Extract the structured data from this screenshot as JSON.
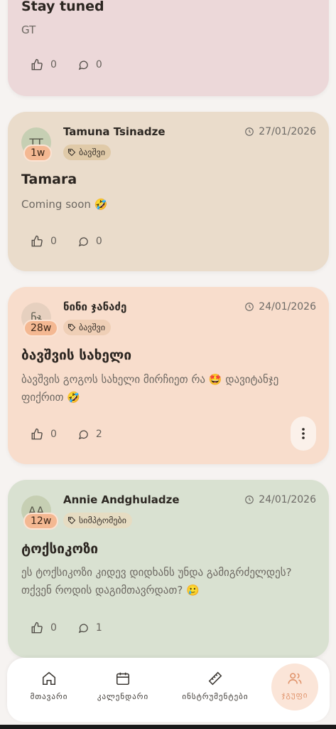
{
  "posts": [
    {
      "title": "Stay tuned",
      "body": "GT",
      "likes": "0",
      "comments": "0"
    },
    {
      "avatar_initials": "TT",
      "week": "1w",
      "author": "Tamuna Tsinadze",
      "tag": "ბავშვი",
      "date": "27/01/2026",
      "title": "Tamara",
      "body": "Coming soon 🤣",
      "likes": "0",
      "comments": "0"
    },
    {
      "avatar_initials": "ნჯ",
      "week": "28w",
      "author": "ნინი ჯანაძე",
      "tag": "ბავშვი",
      "date": "24/01/2026",
      "title": "ბავშვის სახელი",
      "body": "ბავშვის გოგოს სახელი მირჩიეთ რა 🤩 დავიტანჯე ფიქრით 🤣",
      "likes": "0",
      "comments": "2"
    },
    {
      "avatar_initials": "AA",
      "week": "12w",
      "author": "Annie Andghuladze",
      "tag": "სიმპტომები",
      "date": "24/01/2026",
      "title": "ტოქსიკოზი",
      "body": "ეს ტოქსიკოზი კიდევ დიდხანს უნდა გამიგრძელდეს? თქვენ როდის დაგიმთავრდათ? 🥲",
      "likes": "0",
      "comments": "1"
    }
  ],
  "nav": {
    "home": "მთავარი",
    "calendar": "კალენდარი",
    "tools": "ინსტრუმენტები",
    "group": "ჯგუფი"
  }
}
